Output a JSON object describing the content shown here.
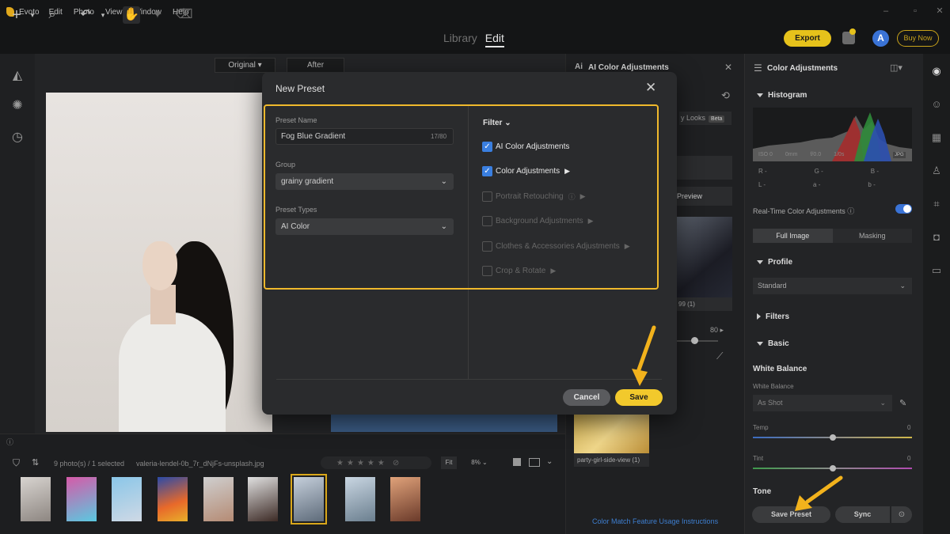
{
  "menubar": {
    "app": "Evoto",
    "items": [
      "Edit",
      "Photo",
      "View",
      "Window",
      "Help"
    ]
  },
  "toolbar": {
    "tabs": [
      {
        "label": "Library",
        "active": false
      },
      {
        "label": "Edit",
        "active": true
      }
    ],
    "export_label": "Export",
    "avatar_letter": "A",
    "buy_now_label": "Buy Now"
  },
  "view_toggle": {
    "original": "Original",
    "after": "After"
  },
  "ai_panel": {
    "title": "AI Color Adjustments",
    "looks_label": "y Looks",
    "beta": "Beta",
    "preview_label": "Preview",
    "thumb_caption": "99 (1)",
    "slider_value": "80",
    "party_caption": "party-girl-side-view (1)",
    "link": "Color Match Feature Usage Instructions"
  },
  "right_panel": {
    "title": "Color Adjustments",
    "histogram": {
      "title": "Histogram",
      "iso": "ISO 0",
      "mm": "0mm",
      "f": "f/0.0",
      "s": "1/0s",
      "format": "JPG",
      "r": "R  -",
      "g": "G  -",
      "b": "B  -",
      "l": "L  -",
      "a": "a  -",
      "bb": "b  -"
    },
    "realtime_label": "Real-Time Color Adjustments ⓘ",
    "segments": [
      "Full Image",
      "Masking"
    ],
    "profile": {
      "title": "Profile",
      "value": "Standard"
    },
    "filters": {
      "title": "Filters"
    },
    "basic": {
      "title": "Basic"
    },
    "white_balance": {
      "title": "White Balance",
      "label": "White Balance",
      "value": "As Shot"
    },
    "temp": {
      "label": "Temp",
      "value": "0",
      "level": 0.5
    },
    "tint": {
      "label": "Tint",
      "value": "0",
      "level": 0.5
    },
    "tone_label": "Tone",
    "save_preset_label": "Save Preset",
    "sync_label": "Sync"
  },
  "filmstrip": {
    "count": "9 photo(s) / 1 selected",
    "filename": "valeria-lendel-0b_7r_dNjFs-unsplash.jpg",
    "fit": "Fit",
    "zoom": "8%"
  },
  "dialog": {
    "title": "New Preset",
    "preset_name_label": "Preset Name",
    "preset_name_value": "Fog Blue Gradient",
    "preset_name_count": "17/80",
    "group_label": "Group",
    "group_value": "grainy gradient",
    "preset_types_label": "Preset Types",
    "preset_types_value": "AI Color",
    "filter_label": "Filter",
    "options": [
      {
        "label": "AI Color Adjustments",
        "checked": true,
        "info": false,
        "expand": false
      },
      {
        "label": "Color Adjustments",
        "checked": true,
        "info": false,
        "expand": true
      },
      {
        "label": "Portrait Retouching",
        "checked": false,
        "info": true,
        "expand": true
      },
      {
        "label": "Background Adjustments",
        "checked": false,
        "info": false,
        "expand": true
      },
      {
        "label": "Clothes & Accessories Adjustments",
        "checked": false,
        "info": false,
        "expand": true
      },
      {
        "label": "Crop & Rotate",
        "checked": false,
        "info": false,
        "expand": true
      }
    ],
    "cancel_label": "Cancel",
    "save_label": "Save"
  },
  "colors": {
    "accent": "#f2c92c",
    "highlight": "#f0b92c",
    "checkbox": "#3a7fe0",
    "arrow": "#f2b21c"
  }
}
